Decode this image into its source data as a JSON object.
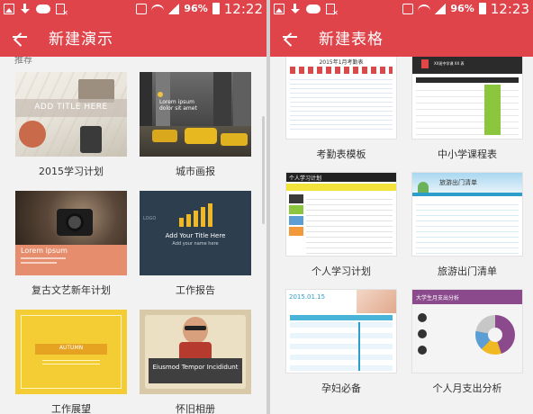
{
  "status_bar": {
    "battery_left": "96%",
    "time_left": "12:22",
    "battery_right": "96%",
    "time_right": "12:23"
  },
  "left": {
    "title": "新建演示",
    "section_label": "推荐",
    "tiles": [
      {
        "caption": "2015学习计划",
        "thumb_text": "ADD TITLE HERE"
      },
      {
        "caption": "城市画报",
        "thumb_text": "Lorem ipsum\ndolor sit amet"
      },
      {
        "caption": "复古文艺新年计划",
        "thumb_text": "Lorem ipsum"
      },
      {
        "caption": "工作报告",
        "thumb_text": "Add Your Title Here",
        "thumb_sub": "Add your name here",
        "logo": "LOGO"
      },
      {
        "caption": "工作展望",
        "thumb_text": "AUTUMN"
      },
      {
        "caption": "怀旧相册",
        "thumb_text": "Eiusmod Tempor Incididunt"
      }
    ]
  },
  "right": {
    "title": "新建表格",
    "tiles": [
      {
        "caption": "考勤表模板",
        "thumb_text": "2015年1月考勤表"
      },
      {
        "caption": "中小学课程表",
        "thumb_text": "XX班中学课 XX 表"
      },
      {
        "caption": "个人学习计划",
        "thumb_text": "个人学习计划"
      },
      {
        "caption": "旅游出门清单",
        "thumb_text": "旅游出门清单"
      },
      {
        "caption": "孕妇必备",
        "thumb_text": "2015.01.15"
      },
      {
        "caption": "个人月支出分析",
        "thumb_text": "大学生月支出分析"
      }
    ]
  },
  "colors": {
    "accent": "#e0444b"
  }
}
